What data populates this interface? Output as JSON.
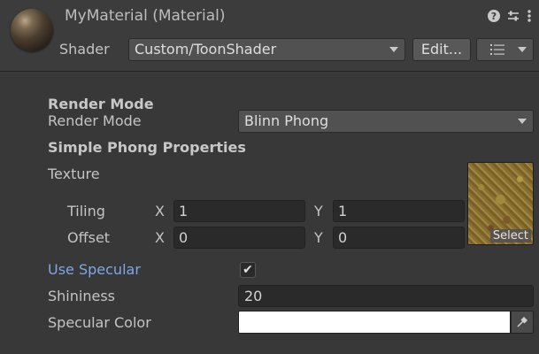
{
  "header": {
    "title": "MyMaterial (Material)",
    "shader_label": "Shader",
    "shader_value": "Custom/ToonShader",
    "edit_button": "Edit..."
  },
  "properties": {
    "section_render_mode": "Render Mode",
    "render_mode_label": "Render Mode",
    "render_mode_value": "Blinn Phong",
    "section_simple_phong": "Simple Phong Properties",
    "texture_label": "Texture",
    "texture_select": "Select",
    "tiling_label": "Tiling",
    "offset_label": "Offset",
    "x_label": "X",
    "y_label": "Y",
    "tiling_x": "1",
    "tiling_y": "1",
    "offset_x": "0",
    "offset_y": "0",
    "use_specular_label": "Use Specular",
    "use_specular_checked": "✔",
    "shininess_label": "Shininess",
    "shininess_value": "20",
    "specular_color_label": "Specular Color",
    "specular_color_value": "#ffffff"
  }
}
